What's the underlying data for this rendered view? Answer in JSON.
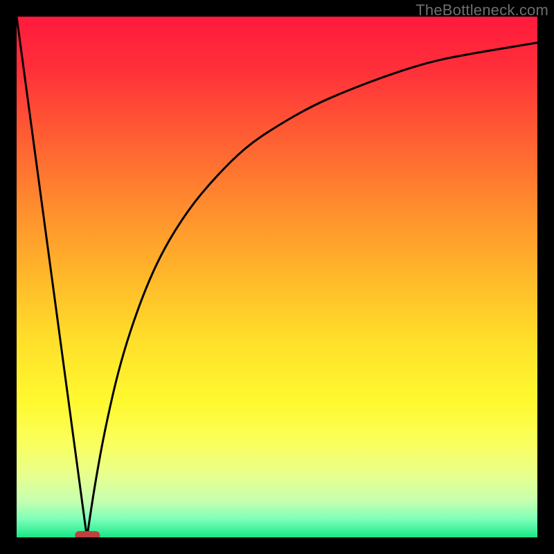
{
  "watermark": "TheBottleneck.com",
  "colors": {
    "frame": "#000000",
    "curve": "#000000",
    "marker": "#c1403d",
    "gradient_stops": [
      {
        "offset": 0.0,
        "color": "#ff1a3c"
      },
      {
        "offset": 0.1,
        "color": "#ff2f3a"
      },
      {
        "offset": 0.22,
        "color": "#ff5a33"
      },
      {
        "offset": 0.36,
        "color": "#ff8b2e"
      },
      {
        "offset": 0.5,
        "color": "#ffb82a"
      },
      {
        "offset": 0.62,
        "color": "#ffdf2a"
      },
      {
        "offset": 0.74,
        "color": "#fff92f"
      },
      {
        "offset": 0.82,
        "color": "#faff5e"
      },
      {
        "offset": 0.88,
        "color": "#e8ff8e"
      },
      {
        "offset": 0.93,
        "color": "#c6ffb0"
      },
      {
        "offset": 0.965,
        "color": "#7dffb9"
      },
      {
        "offset": 1.0,
        "color": "#17e886"
      }
    ]
  },
  "chart_data": {
    "type": "line",
    "title": "",
    "xlabel": "",
    "ylabel": "",
    "xlim": [
      0,
      100
    ],
    "ylim": [
      0,
      100
    ],
    "notch_x": 13.5,
    "marker": {
      "x0": 11.2,
      "x1": 16.0,
      "y": 0
    },
    "series": [
      {
        "name": "left-line",
        "x": [
          0,
          13.5
        ],
        "values": [
          100,
          0
        ]
      },
      {
        "name": "right-curve",
        "x": [
          13.5,
          15,
          17,
          20,
          24,
          28,
          33,
          38,
          44,
          50,
          57,
          64,
          72,
          80,
          88,
          94,
          100
        ],
        "values": [
          0,
          10,
          21,
          34,
          46,
          55,
          63,
          69,
          75,
          79,
          83,
          86,
          89,
          91.5,
          93,
          94,
          95
        ]
      }
    ]
  }
}
